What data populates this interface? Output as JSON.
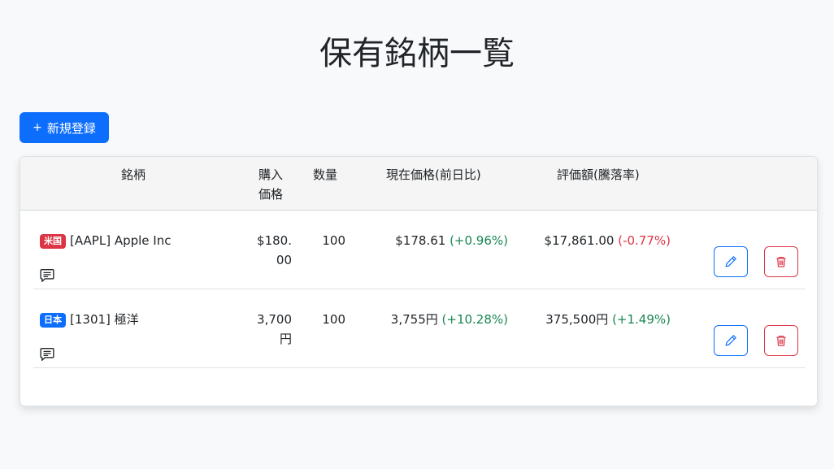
{
  "page": {
    "title": "保有銘柄一覧",
    "new_button_label": "新規登録",
    "new_button_icon": "plus-icon"
  },
  "table": {
    "headers": {
      "name": "銘柄",
      "buy_price": "購入価格",
      "quantity": "数量",
      "current_price": "現在価格(前日比)",
      "valuation": "評価額(騰落率)"
    },
    "rows": [
      {
        "market_badge": "米国",
        "market_color": "#dc3545",
        "name": "[AAPL] Apple Inc",
        "buy_price": "$180.00",
        "quantity": "100",
        "current_price": "$178.61",
        "current_change": "(+0.96%)",
        "current_change_color": "#198754",
        "valuation": "$17,861.00",
        "valuation_change": "(-0.77%)",
        "valuation_change_color": "#dc3545"
      },
      {
        "market_badge": "日本",
        "market_color": "#0d6efd",
        "name": "[1301] 極洋",
        "buy_price": "3,700円",
        "quantity": "100",
        "current_price": "3,755円",
        "current_change": "(+10.28%)",
        "current_change_color": "#198754",
        "valuation": "375,500円",
        "valuation_change": "(+1.49%)",
        "valuation_change_color": "#198754"
      }
    ]
  },
  "icons": {
    "memo": "chat-square-text-icon",
    "edit": "pencil-icon",
    "delete": "trash-icon"
  },
  "colors": {
    "primary": "#0d6efd",
    "danger": "#dc3545",
    "success": "#198754",
    "background": "#f8f9fa"
  }
}
